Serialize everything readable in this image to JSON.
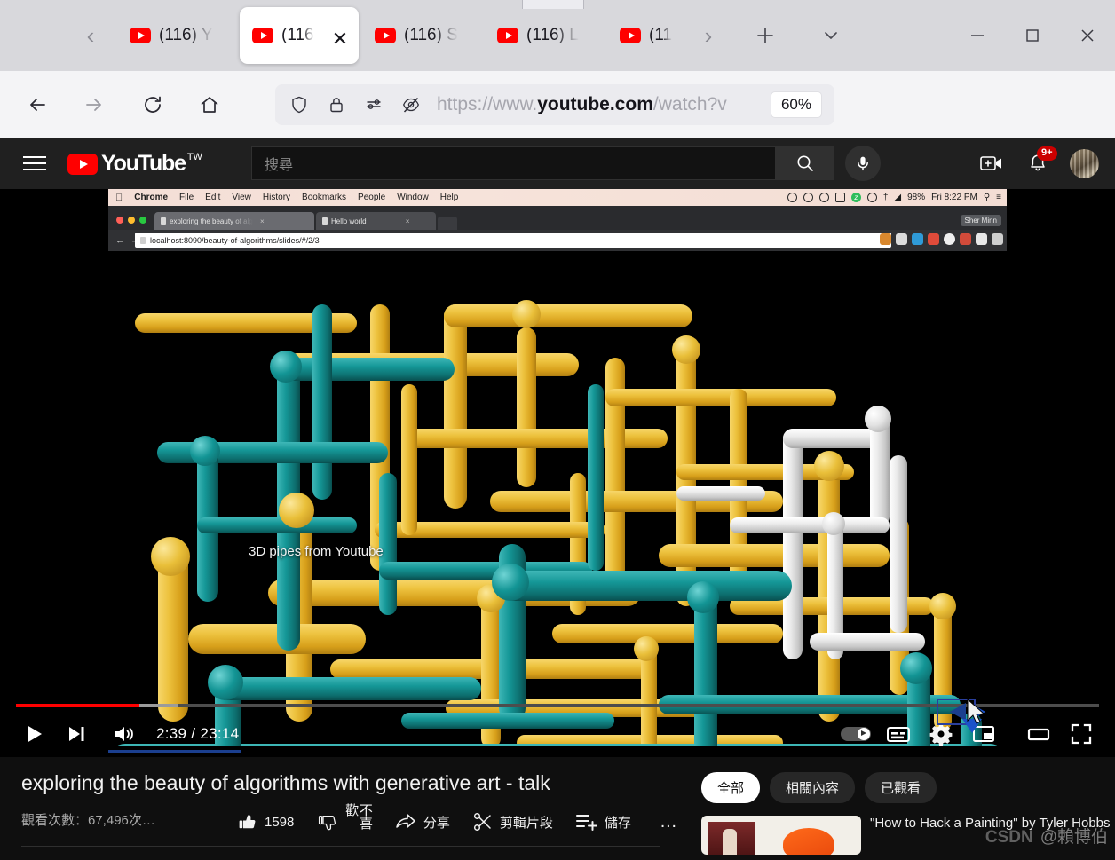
{
  "browser": {
    "tabs": [
      {
        "title": "(116) Y",
        "active": false,
        "favicon": "youtube-icon"
      },
      {
        "title": "(116",
        "active": true,
        "favicon": "youtube-icon"
      },
      {
        "title": "(116) S",
        "active": false,
        "favicon": "youtube-icon"
      },
      {
        "title": "(116) L",
        "active": false,
        "favicon": "youtube-icon"
      },
      {
        "title": "(11",
        "active": false,
        "favicon": "youtube-icon"
      }
    ],
    "tab_scroll_left": "‹",
    "tab_scroll_right": "›",
    "new_tab": "+",
    "list_all_tabs": "⌄",
    "window_minimize": "—",
    "window_maximize": "□",
    "window_close": "✕",
    "nav": {
      "back": "←",
      "forward": "→",
      "reload": "↻",
      "home": "⌂"
    },
    "url": {
      "scheme": "https://www.",
      "domain": "youtube.com",
      "path": "/watch?v",
      "full": "https://www.youtube.com/watch?v"
    },
    "zoom_level": "60%",
    "icons": {
      "shield": "shield-icon",
      "lock": "lock-icon",
      "permissions": "permissions-icon",
      "tracking_off": "tracking-protection-off-icon",
      "bookmark_star": "star-icon",
      "pocket": "pocket-icon",
      "account": "a",
      "menu": "hamburger-menu-icon"
    }
  },
  "youtube": {
    "logo_text": "YouTube",
    "logo_country": "TW",
    "search_placeholder": "搜尋",
    "search_value": "",
    "notifications_badge": "9+",
    "icons": {
      "guide": "hamburger-menu-icon",
      "search": "search-icon",
      "voice": "microphone-icon",
      "create": "create-video-icon",
      "notifications": "bell-icon",
      "avatar": "account-avatar"
    }
  },
  "player": {
    "current_time": "2:39",
    "duration": "23:14",
    "time_display": "2:39 / 23:14",
    "progress_percent": 11.4,
    "buffered_percent": 15.0,
    "caption_overlay": "3D pipes from Youtube",
    "caption_link_word": "Youtube",
    "controls": {
      "play": "play-button",
      "next": "next-video-button",
      "volume": "volume-button",
      "autoplay": "autoplay-toggle",
      "subtitles": "subtitles-button",
      "settings": "settings-gear-button",
      "miniplayer": "miniplayer-button",
      "theater": "theater-mode-button",
      "fullscreen": "fullscreen-button"
    },
    "accent_color": "#ff0000"
  },
  "nested_screenshot": {
    "os_menubar": {
      "apple": "",
      "app": "Chrome",
      "items": [
        "File",
        "Edit",
        "View",
        "History",
        "Bookmarks",
        "People",
        "Window",
        "Help"
      ],
      "battery": "98%",
      "clock": "Fri 8:22 PM"
    },
    "chrome": {
      "tabs": [
        {
          "title": "exploring the beauty of alg",
          "active": true
        },
        {
          "title": "Hello world",
          "active": false
        }
      ],
      "url": "localhost:8090/beauty-of-algorithms/slides/#/2/3",
      "profile": "Sher Minn"
    },
    "slide_colors": {
      "pipe_yellow": "#edc23e",
      "pipe_teal": "#159797",
      "pipe_white": "#ececec",
      "background": "#000000"
    }
  },
  "video_info": {
    "title": "exploring the beauty of algorithms with generative art - talk",
    "views": "觀看次數：67,496次…",
    "like_count": "1598",
    "actions": [
      {
        "label": "1598",
        "icon": "thumbs-up-icon",
        "name": "like-button"
      },
      {
        "label": "不喜歡",
        "icon": "thumbs-down-icon",
        "name": "dislike-button"
      },
      {
        "label": "分享",
        "icon": "share-icon",
        "name": "share-button"
      },
      {
        "label": "剪輯片段",
        "icon": "scissors-icon",
        "name": "clip-button"
      },
      {
        "label": "儲存",
        "icon": "save-playlist-icon",
        "name": "save-button"
      },
      {
        "label": "…",
        "icon": "more-horizontal-icon",
        "name": "more-actions-button"
      }
    ]
  },
  "sidebar": {
    "chips": [
      {
        "label": "全部",
        "active": true
      },
      {
        "label": "相關內容",
        "active": false
      },
      {
        "label": "已觀看",
        "active": false
      }
    ],
    "suggestions": [
      {
        "title": "\"How to Hack a Painting\" by Tyler Hobbs"
      }
    ]
  },
  "watermark": {
    "site": "CSDN",
    "user": "@賴博伯"
  }
}
